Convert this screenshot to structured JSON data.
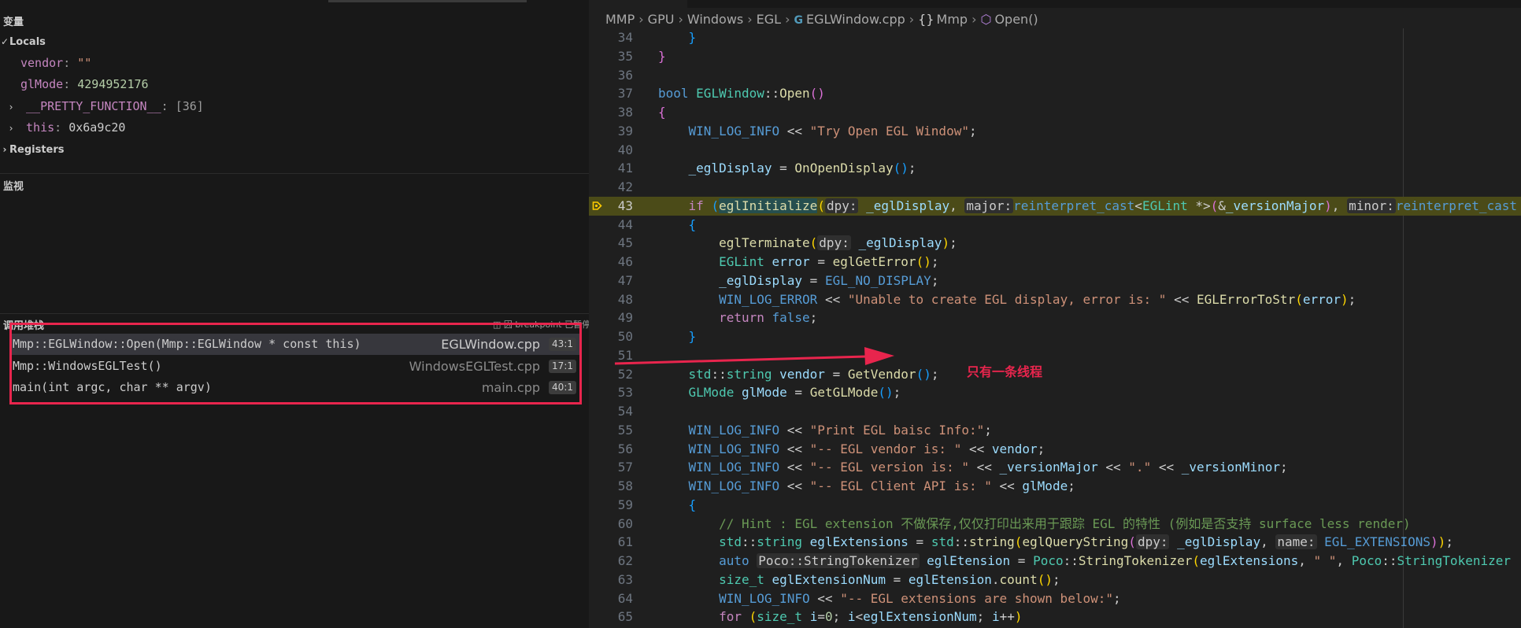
{
  "variables": {
    "title": "变量",
    "locals_label": "Locals",
    "locals": [
      {
        "name": "vendor",
        "value": "\"\"",
        "kind": "string"
      },
      {
        "name": "glMode",
        "value": "4294952176",
        "kind": "number"
      }
    ],
    "pretty_function": {
      "name": "__PRETTY_FUNCTION__",
      "value": "[36]"
    },
    "this_var": {
      "name": "this",
      "value": "0x6a9c20"
    },
    "registers_label": "Registers"
  },
  "watch": {
    "title": "监视"
  },
  "call_stack": {
    "title": "调用堆栈",
    "status": "因 breakpoint 已暂停",
    "frames": [
      {
        "function": "Mmp::EGLWindow::Open(Mmp::EGLWindow * const this)",
        "file": "EGLWindow.cpp",
        "position": "43:1"
      },
      {
        "function": "Mmp::WindowsEGLTest()",
        "file": "WindowsEGLTest.cpp",
        "position": "17:1"
      },
      {
        "function": "main(int argc, char ** argv)",
        "file": "main.cpp",
        "position": "40:1"
      }
    ]
  },
  "breadcrumb": {
    "items": [
      "MMP",
      "GPU",
      "Windows",
      "EGL",
      "EGLWindow.cpp",
      "Mmp",
      "Open()"
    ]
  },
  "annotation": {
    "text": "只有一条线程"
  },
  "editor": {
    "line_numbers": [
      "34",
      "35",
      "36",
      "37",
      "38",
      "39",
      "40",
      "41",
      "42",
      "43",
      "44",
      "45",
      "46",
      "47",
      "48",
      "49",
      "50",
      "51",
      "52",
      "53",
      "54",
      "55",
      "56",
      "57",
      "58",
      "59",
      "60",
      "61",
      "62",
      "63",
      "64",
      "65"
    ],
    "breakpoint_line": "43",
    "tokens": {
      "l39_str": "\"Try Open EGL Window\"",
      "l48_str": "\"Unable to create EGL display, error is: \"",
      "l55_str": "\"Print EGL baisc Info:\"",
      "l56_str": "\"-- EGL vendor is: \"",
      "l57_str": "\"-- EGL version is: \"",
      "l57_dot": "\".\"",
      "l58_str": "\"-- EGL Client API is: \"",
      "l60_cmt": "// Hint : EGL extension 不做保存,仅仅打印出来用于跟踪 EGL 的特性 (例如是否支持 surface less render)",
      "l62_space": "\" \"",
      "l64_str": "\"-- EGL extensions are shown below:\""
    }
  },
  "colors": {
    "accent_annotation": "#e8254d",
    "breakpoint_line_bg": "#4b4b18",
    "breakpoint_icon": "#ffcc00"
  }
}
